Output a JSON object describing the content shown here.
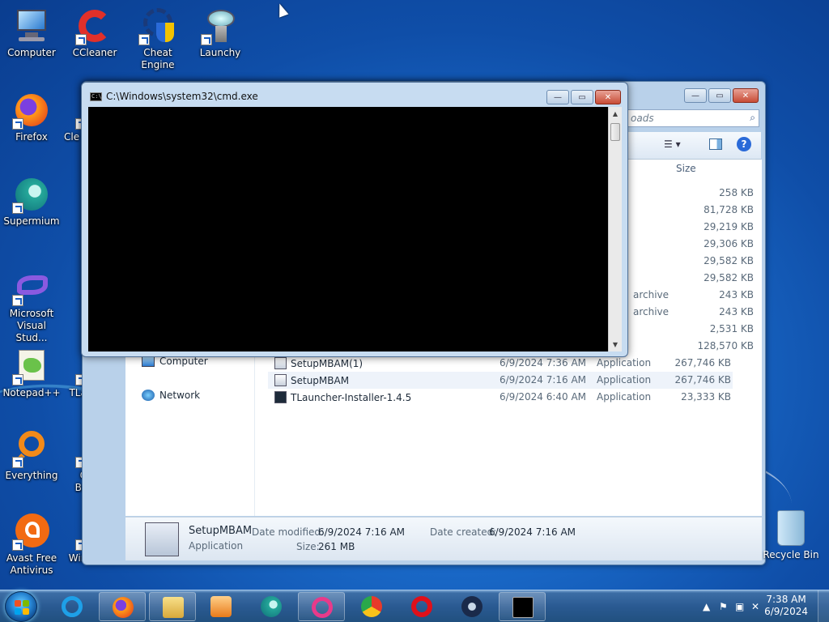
{
  "desktop": {
    "icons": [
      {
        "label": "Computer",
        "icon": "computer-icon"
      },
      {
        "label": "CCleaner",
        "icon": "ccleaner-icon"
      },
      {
        "label": "Cheat Engine",
        "icon": "cheat-engine-icon"
      },
      {
        "label": "Launchy",
        "icon": "launchy-icon"
      },
      {
        "label": "Firefox",
        "icon": "firefox-icon"
      },
      {
        "label": "Cle",
        "icon": "ccleaner-icon"
      },
      {
        "label": "Supermium",
        "icon": "supermium-icon"
      },
      {
        "label": "Microsoft Visual Stud...",
        "icon": "visual-studio-icon"
      },
      {
        "label": "Notepad++",
        "icon": "notepadpp-icon"
      },
      {
        "label": "TLauncher",
        "icon": "tlauncher-icon"
      },
      {
        "label": "Everything",
        "icon": "everything-icon"
      },
      {
        "label": "Opera Browser",
        "icon": "opera-icon"
      },
      {
        "label": "Avast Free Antivirus",
        "icon": "avast-icon"
      },
      {
        "label": "WinDirStat",
        "icon": "windirstat-icon"
      }
    ],
    "recycle_bin": "Recycle Bin"
  },
  "cmd_window": {
    "title": "C:\\Windows\\system32\\cmd.exe"
  },
  "explorer": {
    "search_placeholder": "oads",
    "size_header": "Size",
    "nav": [
      {
        "label": "Computer"
      },
      {
        "label": "Network"
      }
    ],
    "partial_sizes": [
      "258 KB",
      "81,728 KB",
      "29,219 KB",
      "29,306 KB",
      "29,582 KB",
      "29,582 KB",
      "243 KB",
      "243 KB",
      "2,531 KB",
      "128,570 KB"
    ],
    "partial_types": [
      "archive",
      "archive"
    ],
    "files": [
      {
        "name": "SetupMBAM(1)",
        "date": "6/9/2024 7:36 AM",
        "type": "Application",
        "size": "267,746 KB"
      },
      {
        "name": "SetupMBAM",
        "date": "6/9/2024 7:16 AM",
        "type": "Application",
        "size": "267,746 KB"
      },
      {
        "name": "TLauncher-Installer-1.4.5",
        "date": "6/9/2024 6:40 AM",
        "type": "Application",
        "size": "23,333 KB"
      }
    ],
    "details": {
      "name": "SetupMBAM",
      "kind": "Application",
      "modified_label": "Date modified:",
      "modified_value": "6/9/2024 7:16 AM",
      "created_label": "Date created:",
      "created_value": "6/9/2024 7:16 AM",
      "size_label": "Size:",
      "size_value": "261 MB"
    }
  },
  "taskbar": {
    "apps": [
      "internet-explorer-icon",
      "firefox-icon",
      "file-explorer-icon",
      "media-player-icon",
      "supermium-icon",
      "opera-gx-icon",
      "chrome-icon",
      "opera-icon",
      "steam-icon",
      "cmd-icon"
    ],
    "clock_time": "7:38 AM",
    "clock_date": "6/9/2024"
  }
}
